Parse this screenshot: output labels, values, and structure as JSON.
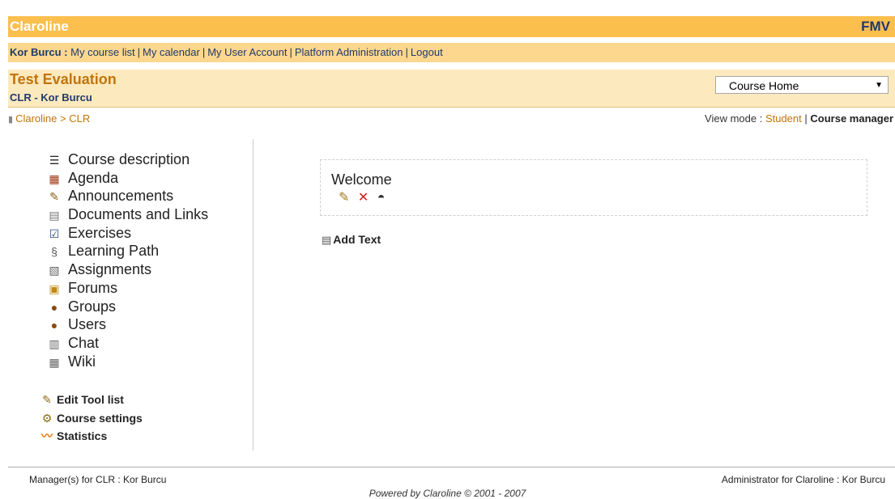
{
  "header": {
    "app_name": "Claroline",
    "institution": "FMV"
  },
  "userbar": {
    "user": "Kor Burcu",
    "colon": " :",
    "links": [
      "My course list",
      "My calendar",
      "My User Account",
      "Platform Administration",
      "Logout"
    ]
  },
  "course": {
    "title": "Test Evaluation",
    "code_line": "CLR - Kor Burcu",
    "select_value": "Course Home"
  },
  "breadcrumb": {
    "root": "Claroline",
    "separator": ">",
    "current": "CLR"
  },
  "view_mode": {
    "label": "View mode :",
    "student": "Student",
    "separator": "|",
    "manager": "Course manager"
  },
  "tools": [
    {
      "label": "Course description",
      "icon": "list-icon",
      "glyph": "☰"
    },
    {
      "label": "Agenda",
      "icon": "calendar-icon",
      "glyph": "▦"
    },
    {
      "label": "Announcements",
      "icon": "announcement-icon",
      "glyph": "✎"
    },
    {
      "label": "Documents and Links",
      "icon": "documents-icon",
      "glyph": "▤"
    },
    {
      "label": "Exercises",
      "icon": "checkbox-icon",
      "glyph": "☑"
    },
    {
      "label": "Learning Path",
      "icon": "path-icon",
      "glyph": "§"
    },
    {
      "label": "Assignments",
      "icon": "assignment-icon",
      "glyph": "▧"
    },
    {
      "label": "Forums",
      "icon": "forum-icon",
      "glyph": "▣"
    },
    {
      "label": "Groups",
      "icon": "groups-icon",
      "glyph": "●"
    },
    {
      "label": "Users",
      "icon": "user-icon",
      "glyph": "●"
    },
    {
      "label": "Chat",
      "icon": "chat-icon",
      "glyph": "▥"
    },
    {
      "label": "Wiki",
      "icon": "wiki-icon",
      "glyph": "▦"
    }
  ],
  "admin": {
    "edit_tool_list": "Edit Tool list",
    "course_settings": "Course settings",
    "statistics": "Statistics"
  },
  "main": {
    "welcome": "Welcome",
    "add_text": "Add Text"
  },
  "footer": {
    "managers": "Manager(s) for CLR : Kor Burcu",
    "administrator": "Administrator for Claroline : Kor Burcu",
    "powered": "Powered by Claroline © 2001 - 2007"
  },
  "colors": {
    "header_bg": "#FBBF4E",
    "userbar_bg": "#FDD78E",
    "coursebar_bg": "#FDE9BE",
    "link_orange": "#C2740A",
    "link_blue": "#1f3a6d"
  }
}
